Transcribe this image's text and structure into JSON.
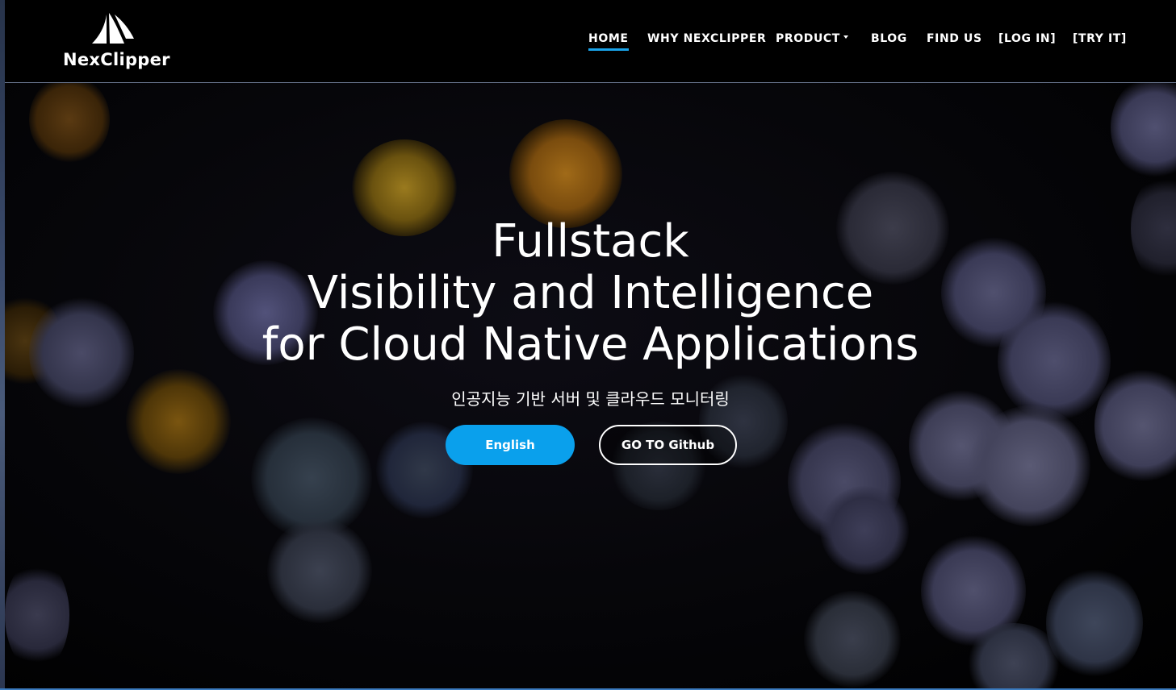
{
  "header": {
    "logo_text": "NexClipper",
    "nav": [
      {
        "label": "HOME",
        "active": true
      },
      {
        "label": "WHY NEXCLIPPER",
        "active": false
      },
      {
        "label": "PRODUCT",
        "active": false,
        "has_dropdown": true
      },
      {
        "label": "BLOG",
        "active": false
      },
      {
        "label": "FIND US",
        "active": false
      },
      {
        "label": "[LOG IN]",
        "active": false
      },
      {
        "label": "[TRY IT]",
        "active": false
      }
    ]
  },
  "hero": {
    "title_lines": [
      "Fullstack",
      "Visibility and Intelligence",
      "for Cloud Native Applications"
    ],
    "subtitle": "인공지능 기반 서버 및 클라우드 모니터링",
    "primary_button": "English",
    "secondary_button": "GO TO Github"
  },
  "colors": {
    "accent": "#0aa0ec",
    "header_bg": "#000000",
    "active_underline": "#19a3ea"
  }
}
